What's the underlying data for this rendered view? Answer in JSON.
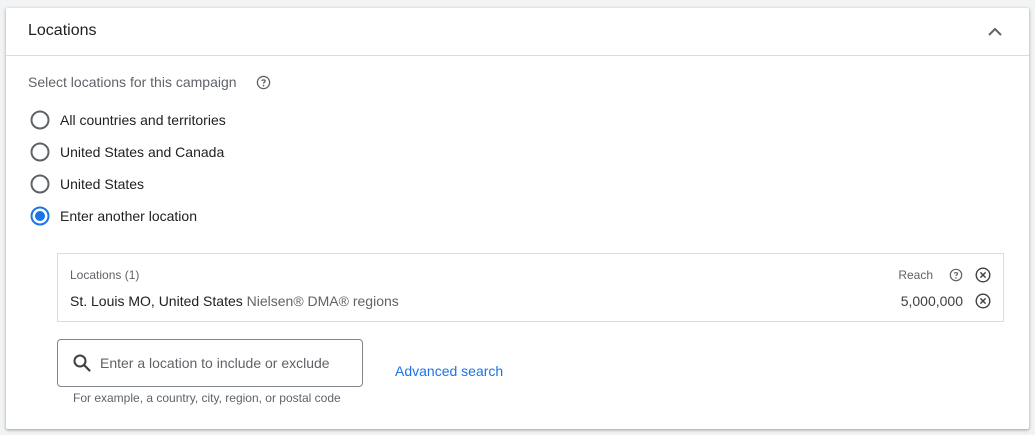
{
  "header": {
    "title": "Locations"
  },
  "section": {
    "prompt": "Select locations for this campaign"
  },
  "radio_options": [
    {
      "label": "All countries and territories",
      "selected": false
    },
    {
      "label": "United States and Canada",
      "selected": false
    },
    {
      "label": "United States",
      "selected": false
    },
    {
      "label": "Enter another location",
      "selected": true
    }
  ],
  "locations_table": {
    "header_label": "Locations (1)",
    "reach_label": "Reach",
    "rows": [
      {
        "name": "St. Louis MO, United States",
        "type": "Nielsen® DMA® regions",
        "reach": "5,000,000"
      }
    ]
  },
  "search": {
    "placeholder": "Enter a location to include or exclude",
    "value": "",
    "hint": "For example, a country, city, region, or postal code"
  },
  "advanced_search_label": "Advanced search",
  "colors": {
    "accent": "#1a73e8",
    "radio_unselected": "#5f6368"
  }
}
